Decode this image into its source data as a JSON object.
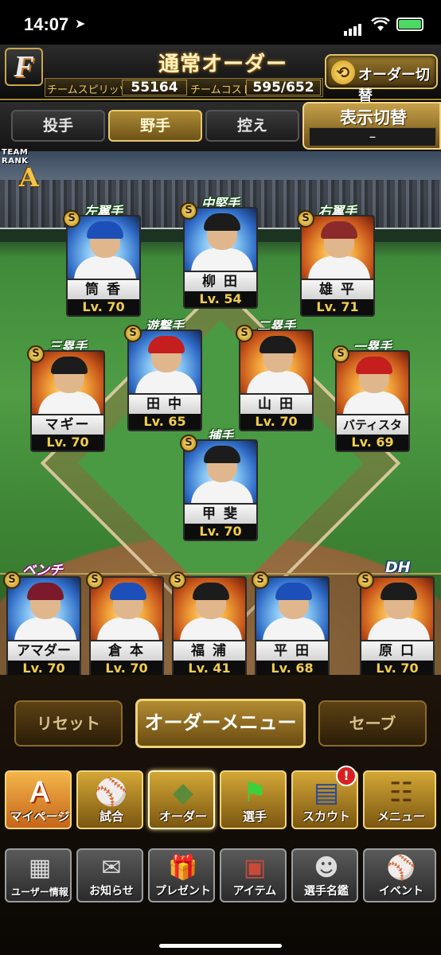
{
  "status_bar": {
    "time": "14:07",
    "nav_glyph": "➤"
  },
  "header": {
    "logo": "F",
    "title": "通常オーダー",
    "team_spirits_label": "チームスピリッツ",
    "team_spirits_value": "55164",
    "team_cost_label": "チームコスト",
    "team_cost_value": "595/652",
    "order_switch_label": "オーダー切替"
  },
  "tabs": [
    {
      "label": "投手",
      "active": false
    },
    {
      "label": "野手",
      "active": true
    },
    {
      "label": "控え",
      "active": false
    }
  ],
  "display_switch": {
    "label": "表示切替",
    "value": "–"
  },
  "team_rank": {
    "label": "TEAM RANK",
    "grade": "A"
  },
  "lineup": [
    {
      "position": "左翼手",
      "name": "筒 香",
      "level": "Lv. 70",
      "rarity": "S",
      "theme": "blue"
    },
    {
      "position": "中堅手",
      "name": "柳 田",
      "level": "Lv. 54",
      "rarity": "S",
      "theme": "blue"
    },
    {
      "position": "右翼手",
      "name": "雄 平",
      "level": "Lv. 71",
      "rarity": "S",
      "theme": "orange"
    },
    {
      "position": "遊撃手",
      "name": "田 中",
      "level": "Lv. 65",
      "rarity": "S",
      "theme": "blue"
    },
    {
      "position": "二塁手",
      "name": "山 田",
      "level": "Lv. 70",
      "rarity": "S",
      "theme": "orange"
    },
    {
      "position": "三塁手",
      "name": "マギー",
      "level": "Lv. 70",
      "rarity": "S",
      "theme": "orange"
    },
    {
      "position": "一塁手",
      "name": "バティスタ",
      "level": "Lv. 69",
      "rarity": "S",
      "theme": "orange"
    },
    {
      "position": "捕手",
      "name": "甲 斐",
      "level": "Lv. 70",
      "rarity": "S",
      "theme": "blue"
    }
  ],
  "bench_label": "ベンチ",
  "dh_label": "DH",
  "bench": [
    {
      "name": "アマダー",
      "level": "Lv. 70",
      "rarity": "S",
      "theme": "blue"
    },
    {
      "name": "倉 本",
      "level": "Lv. 70",
      "rarity": "S",
      "theme": "orange"
    },
    {
      "name": "福 浦",
      "level": "Lv. 41",
      "rarity": "S",
      "theme": "orange"
    },
    {
      "name": "平 田",
      "level": "Lv. 68",
      "rarity": "S",
      "theme": "blue"
    }
  ],
  "dh": {
    "name": "原 口",
    "level": "Lv. 70",
    "rarity": "S",
    "theme": "orange"
  },
  "actions": {
    "reset": "リセット",
    "order_menu": "オーダーメニュー",
    "save": "セーブ"
  },
  "main_nav": [
    {
      "label": "マイページ",
      "icon": "Ａ"
    },
    {
      "label": "試合",
      "icon": "⚾"
    },
    {
      "label": "オーダー",
      "icon": "◆"
    },
    {
      "label": "選手",
      "icon": "⚑"
    },
    {
      "label": "スカウト",
      "icon": "▤"
    },
    {
      "label": "メニュー",
      "icon": "☷"
    }
  ],
  "scout_badge": "!",
  "sub_nav": [
    {
      "label": "ユーザー情報",
      "icon": "▦"
    },
    {
      "label": "お知らせ",
      "icon": "✉"
    },
    {
      "label": "プレゼント",
      "icon": "🎁"
    },
    {
      "label": "アイテム",
      "icon": "▣"
    },
    {
      "label": "選手名鑑",
      "icon": "☻"
    },
    {
      "label": "イベント",
      "icon": "⚾"
    }
  ],
  "colors": {
    "accent_gold": "#e8c46b",
    "level_text": "#f2cd4e",
    "field_green": "#4f9d45"
  }
}
